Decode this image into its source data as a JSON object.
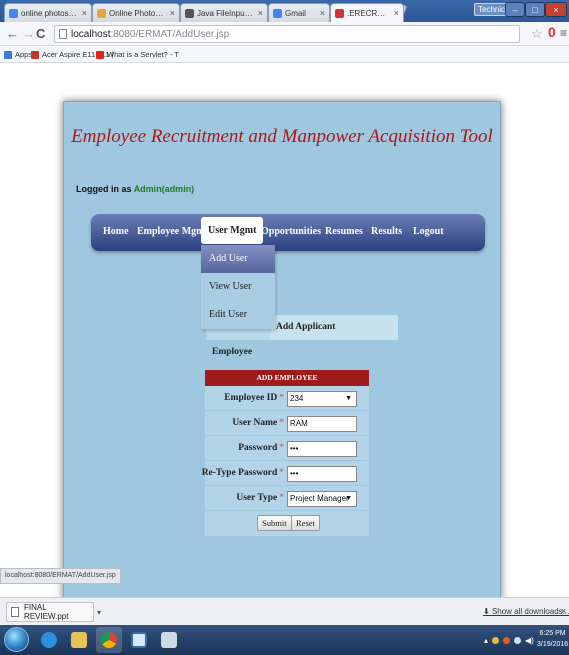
{
  "browser": {
    "tabs": [
      {
        "label": "online photoshop free -",
        "icon": "google-icon",
        "color": "#4285f4"
      },
      {
        "label": "Online Photoshop Free -",
        "icon": "photoshop-icon",
        "color": "#e8a33c"
      },
      {
        "label": "Java FileInputStream and",
        "icon": "tutorials-icon",
        "color": "#555555"
      },
      {
        "label": "Gmail",
        "icon": "gmail-icon",
        "color": "#4285f4"
      },
      {
        "label": ".ERECRUITMENT.",
        "icon": "page-icon",
        "color": "#d33333"
      }
    ],
    "user_badge": "Technical",
    "url": {
      "host": "localhost",
      "path": ":8080/ERMAT/AddUser.jsp"
    },
    "bookmarks": [
      {
        "label": "Apps",
        "icon": "apps-icon",
        "color": "#3a7bd5"
      },
      {
        "label": "Acer Aspire E11-111 |",
        "icon": "acer-icon",
        "color": "#c0392b"
      },
      {
        "label": "What is a Servlet? - T",
        "icon": "youtube-icon",
        "color": "#e62117"
      }
    ]
  },
  "app": {
    "title": "Employee Recruitment and Manpower Acquisition Tool",
    "login_prefix": "Logged in as",
    "login_user": "Admin(admin)",
    "menu": [
      "Home",
      "Employee Mgmt",
      "User Mgmt",
      "Opportunities",
      "Resumes",
      "Results",
      "Logout"
    ],
    "active_menu": "User Mgmt",
    "dropdown": [
      "Add User",
      "View User",
      "Edit User"
    ],
    "subtabs": [
      "Add Employee",
      "Add Applicant"
    ],
    "form": {
      "header": "ADD EMPLOYEE",
      "fields": [
        {
          "label": "Employee ID",
          "value": "234",
          "type": "select"
        },
        {
          "label": "User Name",
          "value": "RAM",
          "type": "text"
        },
        {
          "label": "Password",
          "value": "•••",
          "type": "text"
        },
        {
          "label": "Re-Type Password",
          "value": "•••",
          "type": "text"
        },
        {
          "label": "User Type",
          "value": "Project Manager",
          "type": "select"
        }
      ],
      "required_mark": "*",
      "submit": "Submit",
      "reset": "Reset"
    }
  },
  "status_url": "localhost:8080/ERMAT/AddUser.jsp",
  "downloads": {
    "file": "FINAL REVIEW.ppt",
    "show_all": "Show all downloads...",
    "close": "×"
  },
  "taskbar": {
    "time": "6:25 PM",
    "date": "3/19/2016"
  },
  "colors": {
    "title_red": "#b01717",
    "page_bg": "#9fc7df",
    "menu_dark": "#2c3f80",
    "form_header": "#9d1b1b",
    "login_green": "#1f7b22"
  }
}
